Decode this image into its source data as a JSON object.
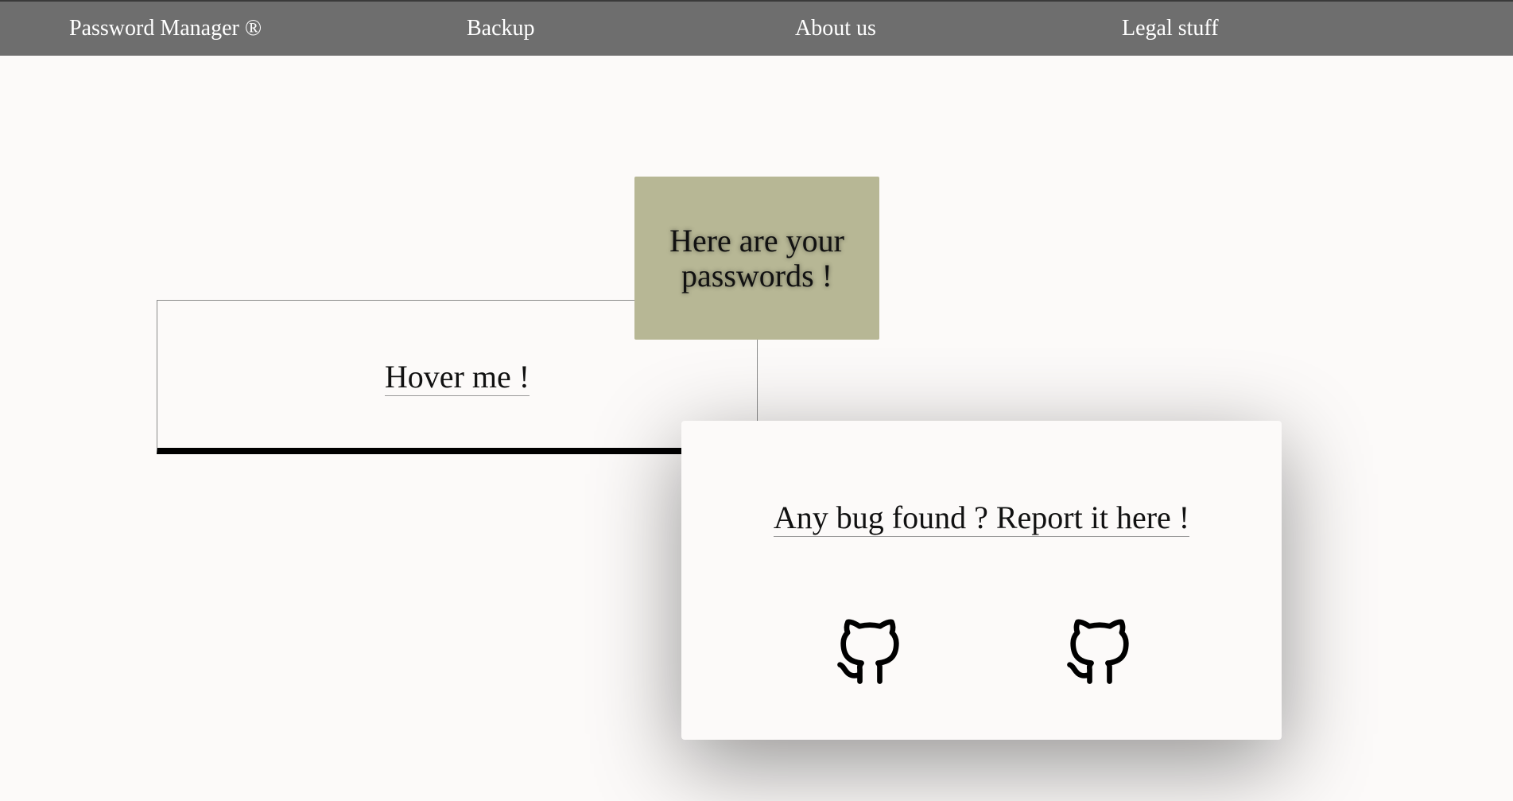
{
  "nav": {
    "brand": "Password Manager ®",
    "backup": "Backup",
    "about": "About us",
    "legal": "Legal stuff"
  },
  "hover_card": {
    "label": "Hover me !"
  },
  "passwords_card": {
    "label": "Here are your passwords !"
  },
  "bug_card": {
    "label": "Any bug found ? Report it here !",
    "links": [
      {
        "icon": "github-icon"
      },
      {
        "icon": "github-icon"
      }
    ]
  },
  "colors": {
    "navbar": "#6e6e6e",
    "background": "#fcfaf9",
    "passwords_card": "#b7b795",
    "text": "#111111"
  }
}
